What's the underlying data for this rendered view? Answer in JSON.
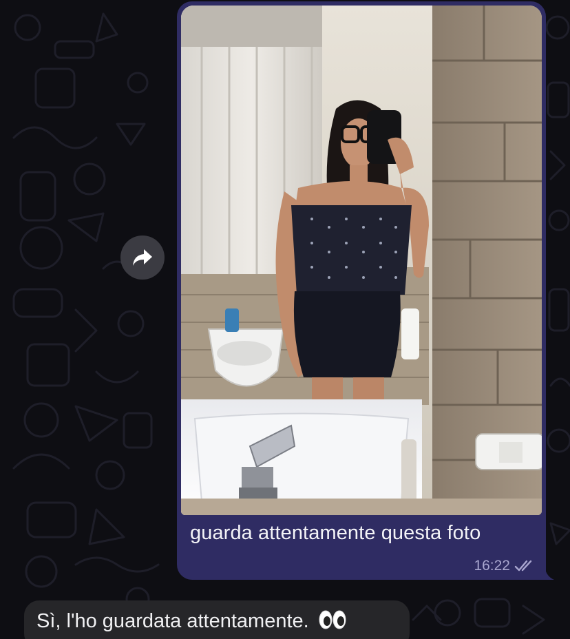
{
  "chat": {
    "messages": [
      {
        "direction": "outgoing",
        "type": "photo",
        "caption": "guarda attentamente questa foto",
        "time": "16:22",
        "status": "read",
        "status_icon": "double-check-icon"
      },
      {
        "direction": "incoming",
        "type": "text",
        "text": "Sì, l'ho guardata attentamente.",
        "emoji": "eyes-emoji"
      }
    ],
    "forward_icon": "forward-arrow-icon"
  },
  "colors": {
    "background": "#0e0e13",
    "outgoing_bubble": "#2f2c63",
    "incoming_bubble": "#262629",
    "meta_text": "#a9a6cf"
  }
}
